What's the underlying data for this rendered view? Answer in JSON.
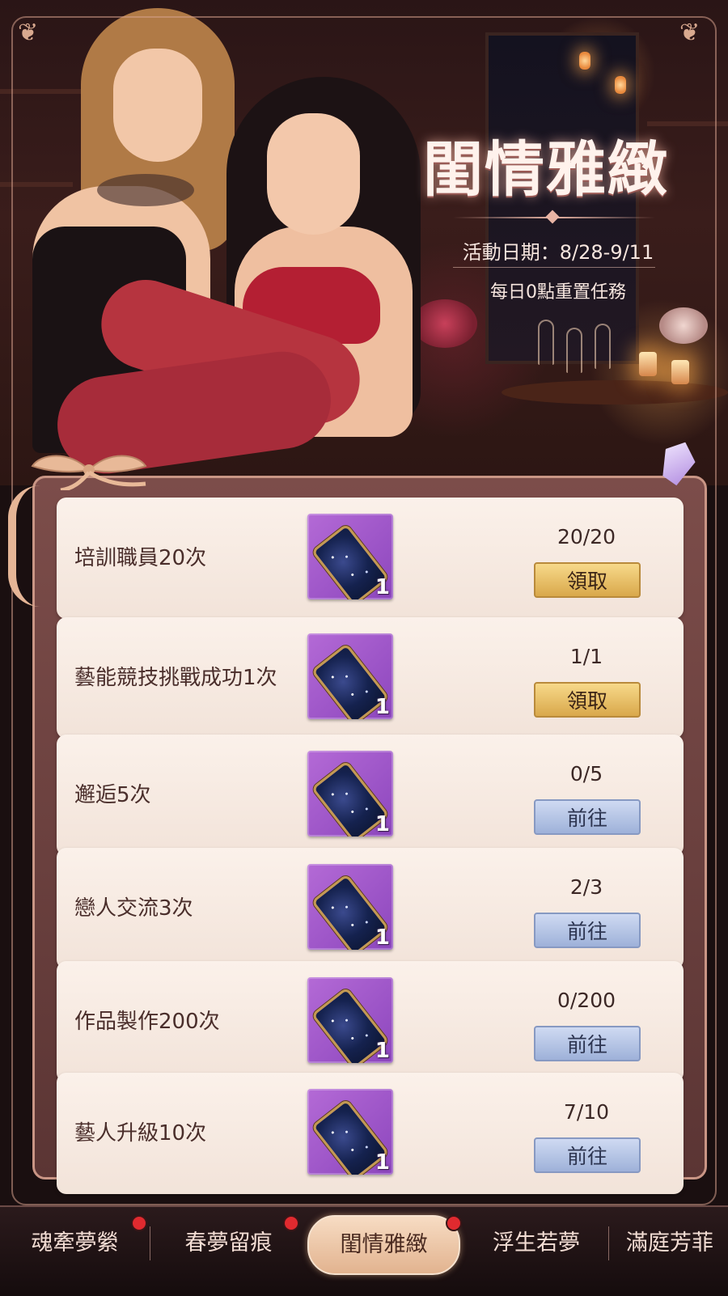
{
  "banner": {
    "title": "閨情雅緻",
    "date_text": "活動日期：8/28-9/11",
    "reset_text": "每日0點重置任務"
  },
  "tasks": [
    {
      "label": "培訓職員20次",
      "reward_qty": "1",
      "progress": "20/20",
      "button": "領取",
      "state": "claim"
    },
    {
      "label": "藝能競技挑戰成功1次",
      "reward_qty": "1",
      "progress": "1/1",
      "button": "領取",
      "state": "claim"
    },
    {
      "label": "邂逅5次",
      "reward_qty": "1",
      "progress": "0/5",
      "button": "前往",
      "state": "go"
    },
    {
      "label": "戀人交流3次",
      "reward_qty": "1",
      "progress": "2/3",
      "button": "前往",
      "state": "go"
    },
    {
      "label": "作品製作200次",
      "reward_qty": "1",
      "progress": "0/200",
      "button": "前往",
      "state": "go"
    },
    {
      "label": "藝人升級10次",
      "reward_qty": "1",
      "progress": "7/10",
      "button": "前往",
      "state": "go"
    }
  ],
  "tabs": [
    {
      "label": "魂牽夢縈",
      "badge": true,
      "active": false
    },
    {
      "label": "春夢留痕",
      "badge": true,
      "active": false
    },
    {
      "label": "閨情雅緻",
      "badge": true,
      "active": true
    },
    {
      "label": "浮生若夢",
      "badge": false,
      "active": false
    },
    {
      "label": "滿庭芳菲",
      "badge": false,
      "active": false
    }
  ],
  "colors": {
    "claim_button": "#e8c06a",
    "go_button": "#b6c4e6",
    "badge": "#e02a2f",
    "reward_bg": "#a35bcf"
  }
}
